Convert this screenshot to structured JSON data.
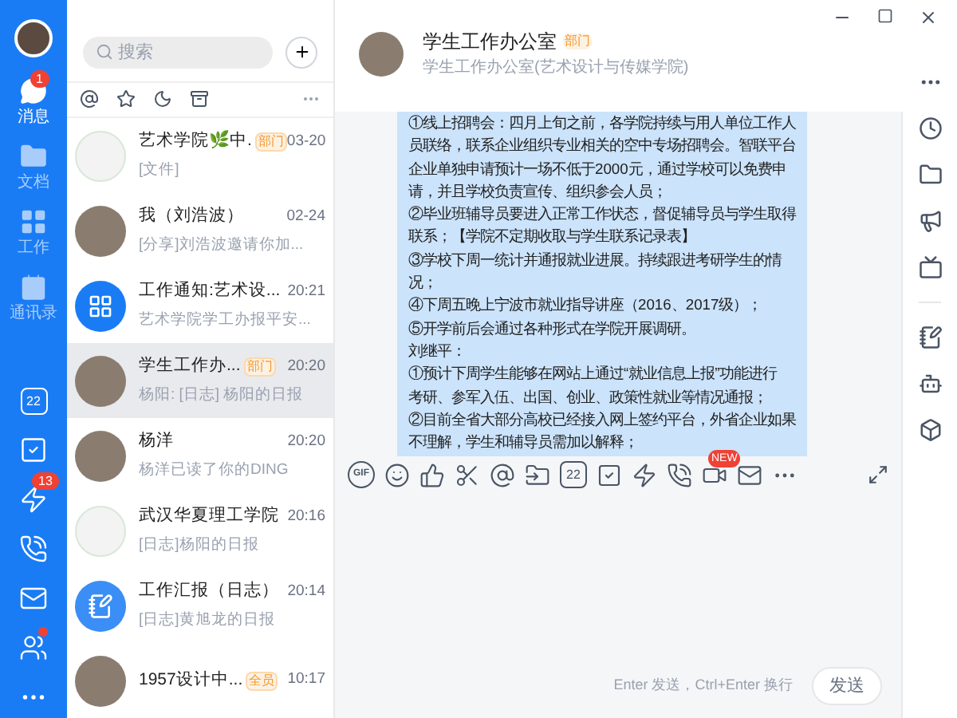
{
  "nav": {
    "items": [
      {
        "label": "消息",
        "kind": "chat",
        "selected": true,
        "badge": "1"
      },
      {
        "label": "文档",
        "kind": "docs",
        "selected": false
      },
      {
        "label": "工作",
        "kind": "work",
        "selected": false
      },
      {
        "label": "通讯录",
        "kind": "contacts",
        "selected": false
      }
    ],
    "tools": [
      {
        "kind": "calendar",
        "text": "22"
      },
      {
        "kind": "todo"
      },
      {
        "kind": "ding",
        "badge": "13"
      },
      {
        "kind": "call"
      },
      {
        "kind": "mail"
      },
      {
        "kind": "group",
        "dot": true
      },
      {
        "kind": "more"
      }
    ]
  },
  "search": {
    "placeholder": "搜索"
  },
  "filters": [
    {
      "kind": "at"
    },
    {
      "kind": "star"
    },
    {
      "kind": "moon"
    },
    {
      "kind": "archive"
    },
    {
      "kind": "more"
    }
  ],
  "conversations": [
    {
      "name": "艺术学院🌿中.",
      "tag": "部门",
      "time": "03-20",
      "preview": "[文件]",
      "kind": "logo",
      "selected": false
    },
    {
      "name": "我（刘浩波）",
      "time": "02-24",
      "preview": "[分享]刘浩波邀请你加...",
      "kind": "photo",
      "selected": false
    },
    {
      "name": "工作通知:艺术设...",
      "time": "20:21",
      "preview": "艺术学院学工办报平安...",
      "kind": "work",
      "selected": false
    },
    {
      "name": "学生工作办...",
      "tag": "部门",
      "time": "20:20",
      "preview": "杨阳: [日志] 杨阳的日报",
      "kind": "photo",
      "selected": true
    },
    {
      "name": "杨洋",
      "time": "20:20",
      "preview": "杨洋已读了你的DING",
      "kind": "photo",
      "selected": false
    },
    {
      "name": "武汉华夏理工学院",
      "time": "20:16",
      "preview": "[日志]杨阳的日报",
      "kind": "logo",
      "selected": false
    },
    {
      "name": "工作汇报（日志）",
      "time": "20:14",
      "preview": "[日志]黄旭龙的日报",
      "kind": "report",
      "selected": false
    },
    {
      "name": "1957设计中...",
      "tag": "全员",
      "time": "10:17",
      "kind": "photo",
      "selected": false
    }
  ],
  "chat": {
    "title": "学生工作办公室",
    "tag": "部门",
    "subtitle": "学生工作办公室(艺术设计与传媒学院)",
    "lines": [
      "①线上招聘会：四月上旬之前，各学院持续与用人单位工作人",
      "员联络，联系企业组织专业相关的空中专场招聘会。智联平台",
      "企业单独申请预计一场不低于2000元，通过学校可以免费申",
      "请，并且学校负责宣传、组织参会人员；",
      "②毕业班辅导员要进入正常工作状态，督促辅导员与学生取得",
      "联系；【学院不定期收取与学生联系记录表】",
      "③学校下周一统计并通报就业进展。持续跟进考研学生的情",
      "况；",
      "④下周五晚上宁波市就业指导讲座（2016、2017级）；",
      "⑤开学前后会通过各种形式在学院开展调研。",
      "刘继平：",
      "①预计下周学生能够在网站上通过“就业信息上报”功能进行",
      "考研、参军入伍、出国、创业、政策性就业等情况通报；",
      "②目前全省大部分高校已经接入网上签约平台，外省企业如果",
      "不理解，学生和辅导员需加以解释；"
    ],
    "toolbar": [
      {
        "kind": "gif",
        "text": "GIF"
      },
      {
        "kind": "emoji"
      },
      {
        "kind": "like"
      },
      {
        "kind": "cut"
      },
      {
        "kind": "at"
      },
      {
        "kind": "file"
      },
      {
        "kind": "calendar",
        "text": "22"
      },
      {
        "kind": "todo"
      },
      {
        "kind": "ding"
      },
      {
        "kind": "call"
      },
      {
        "kind": "live",
        "badge": "NEW"
      },
      {
        "kind": "mail"
      },
      {
        "kind": "more"
      }
    ],
    "hint": "Enter 发送，Ctrl+Enter 换行",
    "send": "发送"
  },
  "rail": [
    {
      "kind": "more"
    },
    {
      "kind": "clock"
    },
    {
      "kind": "folder"
    },
    {
      "kind": "megaphone"
    },
    {
      "kind": "tv"
    },
    {
      "kind": "divider"
    },
    {
      "kind": "note"
    },
    {
      "kind": "robot"
    },
    {
      "kind": "cube"
    }
  ]
}
